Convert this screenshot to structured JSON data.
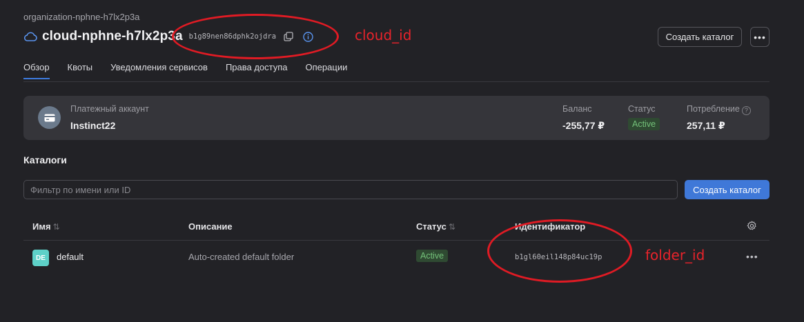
{
  "organization": "organization-nphne-h7lx2p3a",
  "cloud": {
    "title": "cloud-nphne-h7lx2p3a",
    "id": "b1g89nen86dphk2ojdra"
  },
  "header": {
    "create_folder_label": "Создать каталог",
    "more_label": "•••"
  },
  "tabs": [
    {
      "label": "Обзор",
      "active": true
    },
    {
      "label": "Квоты"
    },
    {
      "label": "Уведомления сервисов"
    },
    {
      "label": "Права доступа"
    },
    {
      "label": "Операции"
    }
  ],
  "billing": {
    "label": "Платежный аккаунт",
    "name": "Instinct22",
    "balance_label": "Баланс",
    "balance_value": "-255,77 ₽",
    "status_label": "Статус",
    "status_value": "Active",
    "consumption_label": "Потребление",
    "consumption_value": "257,11 ₽"
  },
  "catalogs": {
    "title": "Каталоги",
    "filter_placeholder": "Фильтр по имени или ID",
    "create_label": "Создать каталог",
    "columns": {
      "name": "Имя",
      "description": "Описание",
      "status": "Статус",
      "id": "Идентификатор"
    },
    "rows": [
      {
        "avatar": "DE",
        "name": "default",
        "description": "Auto-created default folder",
        "status": "Active",
        "id": "b1gl60eil148p84uc19p",
        "more": "•••"
      }
    ]
  },
  "annotations": {
    "cloud_id_label": "cloud_id",
    "folder_id_label": "folder_id",
    "color": "#e01b24"
  },
  "colors": {
    "background": "#222226",
    "accent": "#3f78d8",
    "active_badge_bg": "#2f4a32",
    "active_badge_text": "#74c27a",
    "folder_avatar": "#5ed1c8"
  }
}
